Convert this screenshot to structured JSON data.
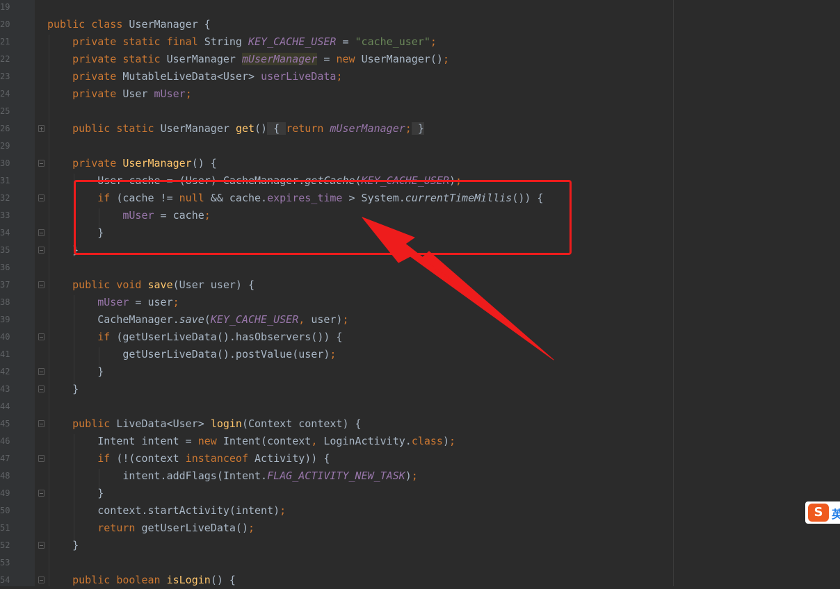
{
  "editor": {
    "lines": [
      {
        "n": "19",
        "tokens": []
      },
      {
        "n": "20",
        "tokens": [
          [
            "k",
            "public class "
          ],
          [
            "p",
            "UserManager {"
          ]
        ]
      },
      {
        "n": "21",
        "tokens": [
          [
            "p",
            "    "
          ],
          [
            "k",
            "private static final "
          ],
          [
            "p",
            "String "
          ],
          [
            "fi",
            "KEY_CACHE_USER"
          ],
          [
            "p",
            " = "
          ],
          [
            "s",
            "\"cache_user\""
          ],
          [
            "k",
            ";"
          ]
        ]
      },
      {
        "n": "22",
        "tokens": [
          [
            "p",
            "    "
          ],
          [
            "k",
            "private static "
          ],
          [
            "p",
            "UserManager "
          ],
          [
            "fih",
            "mUserManager"
          ],
          [
            "p",
            " = "
          ],
          [
            "k",
            "new "
          ],
          [
            "p",
            "UserManager()"
          ],
          [
            "k",
            ";"
          ]
        ]
      },
      {
        "n": "23",
        "tokens": [
          [
            "p",
            "    "
          ],
          [
            "k",
            "private "
          ],
          [
            "p",
            "MutableLiveData<User> "
          ],
          [
            "f",
            "userLiveData"
          ],
          [
            "k",
            ";"
          ]
        ]
      },
      {
        "n": "24",
        "tokens": [
          [
            "p",
            "    "
          ],
          [
            "k",
            "private "
          ],
          [
            "p",
            "User "
          ],
          [
            "f",
            "mUser"
          ],
          [
            "k",
            ";"
          ]
        ]
      },
      {
        "n": "25",
        "tokens": []
      },
      {
        "n": "26",
        "tokens": [
          [
            "p",
            "    "
          ],
          [
            "k",
            "public static "
          ],
          [
            "p",
            "UserManager "
          ],
          [
            "m",
            "get"
          ],
          [
            "p",
            "()"
          ],
          [
            "fb",
            " { "
          ],
          [
            "k",
            "return "
          ],
          [
            "fi",
            "mUserManager"
          ],
          [
            "k",
            ";"
          ],
          [
            "fb",
            " }"
          ]
        ]
      },
      {
        "n": "29",
        "tokens": []
      },
      {
        "n": "30",
        "tokens": [
          [
            "p",
            "    "
          ],
          [
            "k",
            "private "
          ],
          [
            "m",
            "UserManager"
          ],
          [
            "p",
            "() {"
          ]
        ]
      },
      {
        "n": "31",
        "tokens": [
          [
            "p",
            "        User cache = (User) CacheManager."
          ],
          [
            "i",
            "getCache"
          ],
          [
            "p",
            "("
          ],
          [
            "fi",
            "KEY_CACHE_USER"
          ],
          [
            "p",
            ")"
          ],
          [
            "k",
            ";"
          ]
        ]
      },
      {
        "n": "32",
        "tokens": [
          [
            "p",
            "        "
          ],
          [
            "k",
            "if "
          ],
          [
            "p",
            "(cache != "
          ],
          [
            "k",
            "null "
          ],
          [
            "p",
            "&& cache."
          ],
          [
            "f",
            "expires_time"
          ],
          [
            "p",
            " > System."
          ],
          [
            "i",
            "currentTimeMillis"
          ],
          [
            "p",
            "()) {"
          ]
        ]
      },
      {
        "n": "33",
        "tokens": [
          [
            "p",
            "            "
          ],
          [
            "f",
            "mUser"
          ],
          [
            "p",
            " = cache"
          ],
          [
            "k",
            ";"
          ]
        ]
      },
      {
        "n": "34",
        "tokens": [
          [
            "p",
            "        }"
          ]
        ]
      },
      {
        "n": "35",
        "tokens": [
          [
            "p",
            "    }"
          ]
        ]
      },
      {
        "n": "36",
        "tokens": []
      },
      {
        "n": "37",
        "tokens": [
          [
            "p",
            "    "
          ],
          [
            "k",
            "public void "
          ],
          [
            "m",
            "save"
          ],
          [
            "p",
            "(User user) {"
          ]
        ]
      },
      {
        "n": "38",
        "tokens": [
          [
            "p",
            "        "
          ],
          [
            "f",
            "mUser"
          ],
          [
            "p",
            " = user"
          ],
          [
            "k",
            ";"
          ]
        ]
      },
      {
        "n": "39",
        "tokens": [
          [
            "p",
            "        CacheManager."
          ],
          [
            "i",
            "save"
          ],
          [
            "p",
            "("
          ],
          [
            "fi",
            "KEY_CACHE_USER"
          ],
          [
            "k",
            ", "
          ],
          [
            "p",
            "user)"
          ],
          [
            "k",
            ";"
          ]
        ]
      },
      {
        "n": "40",
        "tokens": [
          [
            "p",
            "        "
          ],
          [
            "k",
            "if "
          ],
          [
            "p",
            "(getUserLiveData().hasObservers()) {"
          ]
        ]
      },
      {
        "n": "41",
        "tokens": [
          [
            "p",
            "            getUserLiveData().postValue(user)"
          ],
          [
            "k",
            ";"
          ]
        ]
      },
      {
        "n": "42",
        "tokens": [
          [
            "p",
            "        }"
          ]
        ]
      },
      {
        "n": "43",
        "tokens": [
          [
            "p",
            "    }"
          ]
        ]
      },
      {
        "n": "44",
        "tokens": []
      },
      {
        "n": "45",
        "tokens": [
          [
            "p",
            "    "
          ],
          [
            "k",
            "public "
          ],
          [
            "p",
            "LiveData<User> "
          ],
          [
            "m",
            "login"
          ],
          [
            "p",
            "(Context context) {"
          ]
        ]
      },
      {
        "n": "46",
        "tokens": [
          [
            "p",
            "        Intent intent = "
          ],
          [
            "k",
            "new "
          ],
          [
            "p",
            "Intent(context"
          ],
          [
            "k",
            ", "
          ],
          [
            "p",
            "LoginActivity."
          ],
          [
            "k",
            "class"
          ],
          [
            "p",
            ")"
          ],
          [
            "k",
            ";"
          ]
        ]
      },
      {
        "n": "47",
        "tokens": [
          [
            "p",
            "        "
          ],
          [
            "k",
            "if "
          ],
          [
            "p",
            "(!(context "
          ],
          [
            "k",
            "instanceof "
          ],
          [
            "p",
            "Activity)) {"
          ]
        ]
      },
      {
        "n": "48",
        "tokens": [
          [
            "p",
            "            intent.addFlags(Intent."
          ],
          [
            "fi",
            "FLAG_ACTIVITY_NEW_TASK"
          ],
          [
            "p",
            ")"
          ],
          [
            "k",
            ";"
          ]
        ]
      },
      {
        "n": "49",
        "tokens": [
          [
            "p",
            "        }"
          ]
        ]
      },
      {
        "n": "50",
        "tokens": [
          [
            "p",
            "        context.startActivity(intent)"
          ],
          [
            "k",
            ";"
          ]
        ]
      },
      {
        "n": "51",
        "tokens": [
          [
            "p",
            "        "
          ],
          [
            "k",
            "return "
          ],
          [
            "p",
            "getUserLiveData()"
          ],
          [
            "k",
            ";"
          ]
        ]
      },
      {
        "n": "52",
        "tokens": [
          [
            "p",
            "    }"
          ]
        ]
      },
      {
        "n": "53",
        "tokens": []
      },
      {
        "n": "54",
        "tokens": [
          [
            "p",
            "    "
          ],
          [
            "k",
            "public boolean "
          ],
          [
            "m",
            "isLogin"
          ],
          [
            "p",
            "() {"
          ]
        ]
      }
    ]
  },
  "ime": {
    "logo": "S",
    "label": "英"
  },
  "colors": {
    "annotation": "#ee1c1c",
    "background": "#2b2b2b",
    "keyword": "#cc7832"
  }
}
